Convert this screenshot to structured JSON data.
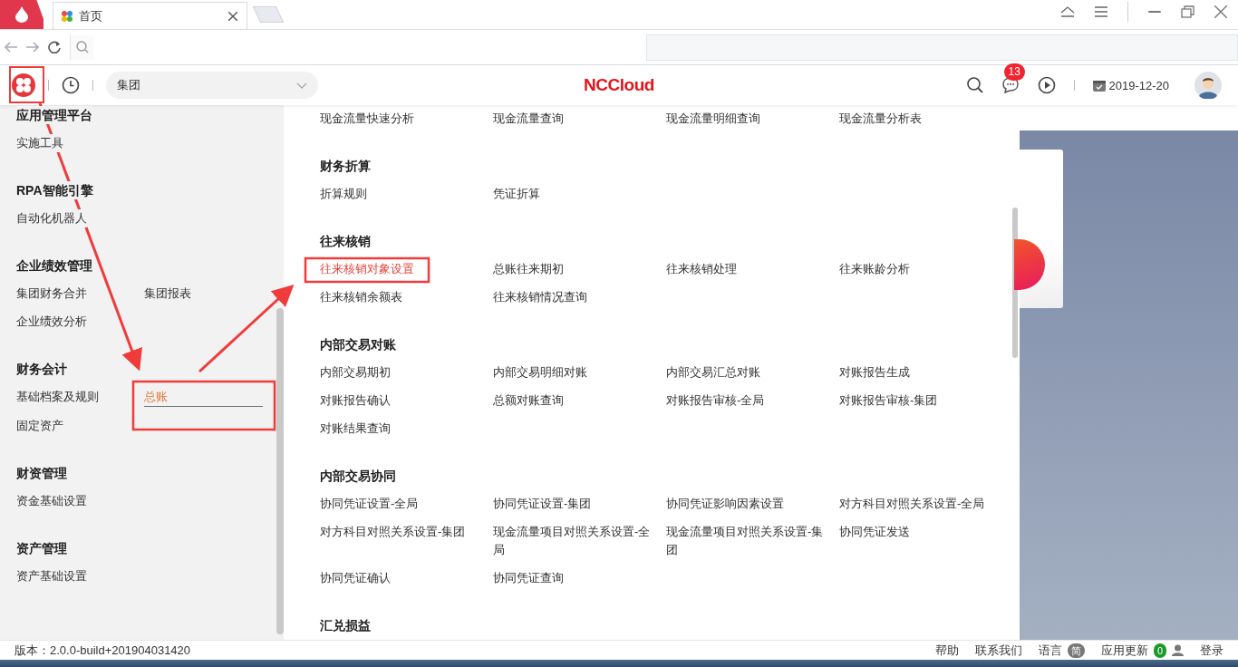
{
  "browser": {
    "tab": {
      "title": "首页"
    }
  },
  "header": {
    "org_select": {
      "value": "集团"
    },
    "logo": "NCCloud",
    "message_badge": "13",
    "date": "2019-12-20"
  },
  "sidebar": {
    "groups": [
      {
        "title": "应用管理平台",
        "items": [
          {
            "label": "实施工具",
            "selected": false
          }
        ]
      },
      {
        "title": "RPA智能引擎",
        "items": [
          {
            "label": "自动化机器人",
            "selected": false
          }
        ]
      },
      {
        "title": "企业绩效管理",
        "items": [
          {
            "label": "集团财务合并",
            "selected": false
          },
          {
            "label": "集团报表",
            "selected": false
          },
          {
            "label": "企业绩效分析",
            "selected": false
          }
        ]
      },
      {
        "title": "财务会计",
        "items": [
          {
            "label": "基础档案及规则",
            "selected": false
          },
          {
            "label": "总账",
            "selected": true
          },
          {
            "label": "固定资产",
            "selected": false
          }
        ]
      },
      {
        "title": "财资管理",
        "items": [
          {
            "label": "资金基础设置",
            "selected": false
          }
        ]
      },
      {
        "title": "资产管理",
        "items": [
          {
            "label": "资产基础设置",
            "selected": false
          }
        ]
      }
    ]
  },
  "menu": {
    "groups": [
      {
        "items": [
          {
            "label": "现金流量快速分析",
            "selected": false
          },
          {
            "label": "现金流量查询",
            "selected": false
          },
          {
            "label": "现金流量明细查询",
            "selected": false
          },
          {
            "label": "现金流量分析表",
            "selected": false
          }
        ]
      },
      {
        "title": "财务折算",
        "items": [
          {
            "label": "折算规则",
            "selected": false
          },
          {
            "label": "凭证折算",
            "selected": false
          }
        ]
      },
      {
        "title": "往来核销",
        "items": [
          {
            "label": "往来核销对象设置",
            "selected": true
          },
          {
            "label": "总账往来期初",
            "selected": false
          },
          {
            "label": "往来核销处理",
            "selected": false
          },
          {
            "label": "往来账龄分析",
            "selected": false
          },
          {
            "label": "往来核销余额表",
            "selected": false
          },
          {
            "label": "往来核销情况查询",
            "selected": false
          }
        ]
      },
      {
        "title": "内部交易对账",
        "items": [
          {
            "label": "内部交易期初",
            "selected": false
          },
          {
            "label": "内部交易明细对账",
            "selected": false
          },
          {
            "label": "内部交易汇总对账",
            "selected": false
          },
          {
            "label": "对账报告生成",
            "selected": false
          },
          {
            "label": "对账报告确认",
            "selected": false
          },
          {
            "label": "总额对账查询",
            "selected": false
          },
          {
            "label": "对账报告审核-全局",
            "selected": false
          },
          {
            "label": "对账报告审核-集团",
            "selected": false
          },
          {
            "label": "对账结果查询",
            "selected": false
          }
        ]
      },
      {
        "title": "内部交易协同",
        "items": [
          {
            "label": "协同凭证设置-全局",
            "selected": false
          },
          {
            "label": "协同凭证设置-集团",
            "selected": false
          },
          {
            "label": "协同凭证影响因素设置",
            "selected": false
          },
          {
            "label": "对方科目对照关系设置-全局",
            "selected": false
          },
          {
            "label": "对方科目对照关系设置-集团",
            "selected": false
          },
          {
            "label": "现金流量项目对照关系设置-全局",
            "selected": false
          },
          {
            "label": "现金流量项目对照关系设置-集团",
            "selected": false
          },
          {
            "label": "协同凭证发送",
            "selected": false
          },
          {
            "label": "协同凭证确认",
            "selected": false
          },
          {
            "label": "协同凭证查询",
            "selected": false
          }
        ]
      },
      {
        "title": "汇兑损益"
      }
    ]
  },
  "status_bar": {
    "version": "版本：2.0.0-build+201904031420",
    "help": "帮助",
    "contact": "联系我们",
    "language": "语言",
    "language_badge": "简",
    "updates": "应用更新",
    "updates_badge": "0",
    "login": "登录"
  }
}
